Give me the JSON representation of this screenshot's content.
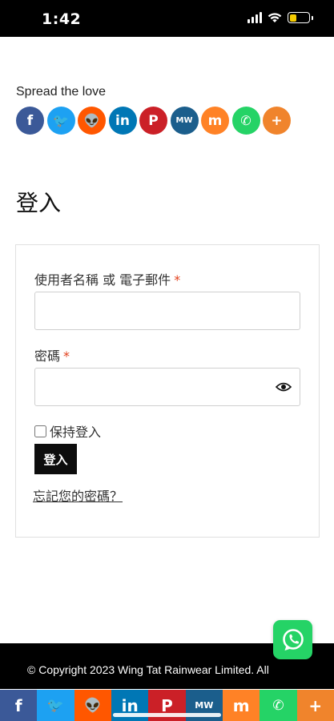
{
  "status_bar": {
    "time": "1:42",
    "battery_level": 0.35,
    "battery_color": "#f5cc00"
  },
  "share": {
    "title": "Spread the love",
    "buttons": [
      {
        "name": "facebook",
        "glyph": "f",
        "color": "#3b5998",
        "icon": "facebook-icon"
      },
      {
        "name": "twitter",
        "glyph": "🐦",
        "color": "#1da1f2",
        "icon": "twitter-icon"
      },
      {
        "name": "reddit",
        "glyph": "👽",
        "color": "#ff5700",
        "icon": "reddit-icon"
      },
      {
        "name": "linkedin",
        "glyph": "in",
        "color": "#0077b5",
        "icon": "linkedin-icon"
      },
      {
        "name": "pinterest",
        "glyph": "P",
        "color": "#cb2027",
        "icon": "pinterest-icon"
      },
      {
        "name": "mewe",
        "glyph": "MW",
        "color": "#1b5e8c",
        "icon": "mewe-icon"
      },
      {
        "name": "mix",
        "glyph": "m",
        "color": "#ff8226",
        "icon": "mix-icon"
      },
      {
        "name": "whatsapp",
        "glyph": "✆",
        "color": "#25d366",
        "icon": "whatsapp-icon"
      },
      {
        "name": "more",
        "glyph": "+",
        "color": "#f0842c",
        "icon": "plus-icon"
      }
    ]
  },
  "page": {
    "heading": "登入"
  },
  "login_form": {
    "username_label": "使用者名稱 或 電子郵件",
    "username_value": "",
    "password_label": "密碼",
    "password_value": "",
    "required_mark": "*",
    "remember_label": "保持登入",
    "remember_checked": false,
    "submit_label": "登入",
    "lost_password": "忘記您的密碼？"
  },
  "footer": {
    "copyright": "© Copyright 2023 Wing Tat Rainwear Limited. All"
  },
  "bottom_share_bar": [
    {
      "name": "facebook",
      "glyph": "f",
      "color": "#3b5998",
      "icon": "facebook-icon"
    },
    {
      "name": "twitter",
      "glyph": "🐦",
      "color": "#1da1f2",
      "icon": "twitter-icon"
    },
    {
      "name": "reddit",
      "glyph": "👽",
      "color": "#ff5700",
      "icon": "reddit-icon"
    },
    {
      "name": "linkedin",
      "glyph": "in",
      "color": "#0077b5",
      "icon": "linkedin-icon"
    },
    {
      "name": "pinterest",
      "glyph": "P",
      "color": "#cb2027",
      "icon": "pinterest-icon"
    },
    {
      "name": "mewe",
      "glyph": "MW",
      "color": "#1b5e8c",
      "icon": "mewe-icon"
    },
    {
      "name": "mix",
      "glyph": "m",
      "color": "#ff8226",
      "icon": "mix-icon"
    },
    {
      "name": "whatsapp",
      "glyph": "✆",
      "color": "#25d366",
      "icon": "whatsapp-icon"
    },
    {
      "name": "more",
      "glyph": "+",
      "color": "#f0842c",
      "icon": "plus-icon"
    }
  ]
}
